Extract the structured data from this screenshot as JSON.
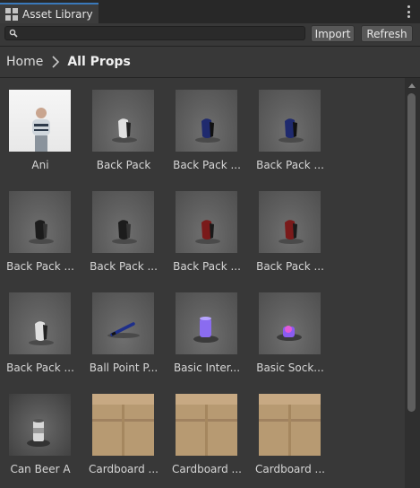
{
  "window": {
    "tab_title": "Asset Library",
    "tab_icon": "grid-icon",
    "menu_icon": "kebab-menu-icon"
  },
  "toolbar": {
    "search_placeholder": "",
    "search_value": "",
    "search_icon": "search-icon",
    "import_label": "Import",
    "refresh_label": "Refresh"
  },
  "breadcrumb": {
    "home": "Home",
    "separator_icon": "chevron-right-icon",
    "current": "All Props"
  },
  "assets": [
    {
      "label": "Ani",
      "thumb": "character"
    },
    {
      "label": "Back Pack",
      "thumb": "backpack-white"
    },
    {
      "label": "Back Pack ...",
      "thumb": "backpack-blue"
    },
    {
      "label": "Back Pack ...",
      "thumb": "backpack-blue"
    },
    {
      "label": "Back Pack ...",
      "thumb": "backpack-black"
    },
    {
      "label": "Back Pack ...",
      "thumb": "backpack-black"
    },
    {
      "label": "Back Pack ...",
      "thumb": "backpack-red"
    },
    {
      "label": "Back Pack ...",
      "thumb": "backpack-red"
    },
    {
      "label": "Back Pack ...",
      "thumb": "backpack-white"
    },
    {
      "label": "Ball Point P...",
      "thumb": "pen"
    },
    {
      "label": "Basic Inter...",
      "thumb": "cylinder-purple"
    },
    {
      "label": "Basic Sock...",
      "thumb": "socket"
    },
    {
      "label": "Can Beer A",
      "thumb": "can"
    },
    {
      "label": "Cardboard ...",
      "thumb": "box"
    },
    {
      "label": "Cardboard ...",
      "thumb": "box"
    },
    {
      "label": "Cardboard ...",
      "thumb": "box"
    }
  ],
  "colors": {
    "panel_bg": "#383838",
    "tab_accent": "#3a79bb",
    "button_bg": "#585858"
  }
}
